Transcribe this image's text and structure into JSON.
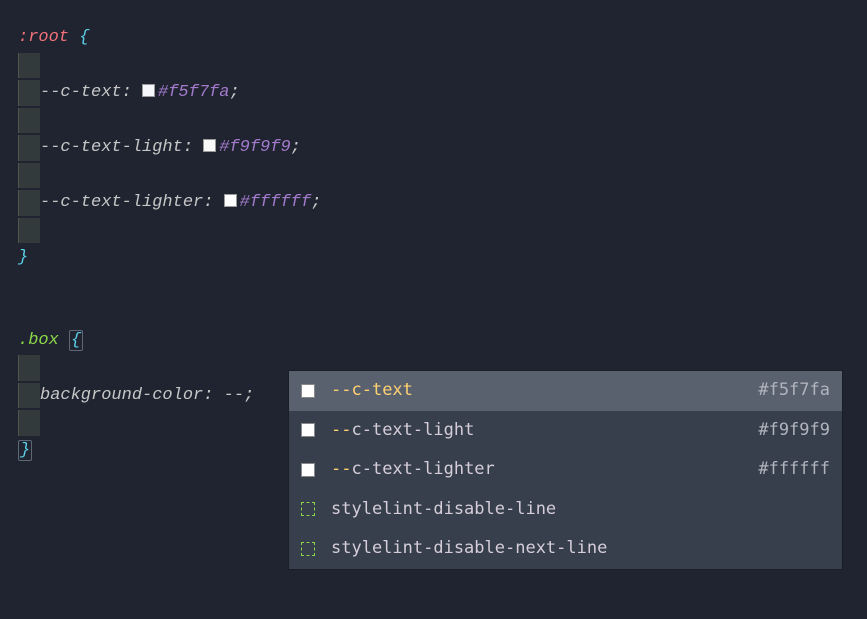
{
  "code": {
    "root_selector": ":root",
    "vars": [
      {
        "name": "--c-text",
        "value": "#f5f7fa",
        "swatch": "#f5f7fa"
      },
      {
        "name": "--c-text-light",
        "value": "#f9f9f9",
        "swatch": "#f9f9f9"
      },
      {
        "name": "--c-text-lighter",
        "value": "#ffffff",
        "swatch": "#ffffff"
      }
    ],
    "box_selector": ".box",
    "box_prop": "background-color",
    "box_partial": "--"
  },
  "autocomplete": {
    "items": [
      {
        "type": "var",
        "prefix": "--",
        "rest": "c-text",
        "value": "#f5f7fa",
        "selected": true
      },
      {
        "type": "var",
        "prefix": "--",
        "rest": "c-text-light",
        "value": "#f9f9f9",
        "selected": false
      },
      {
        "type": "var",
        "prefix": "--",
        "rest": "c-text-lighter",
        "value": "#ffffff",
        "selected": false
      },
      {
        "type": "snippet",
        "label": "stylelint-disable-line"
      },
      {
        "type": "snippet",
        "label": "stylelint-disable-next-line"
      }
    ]
  }
}
